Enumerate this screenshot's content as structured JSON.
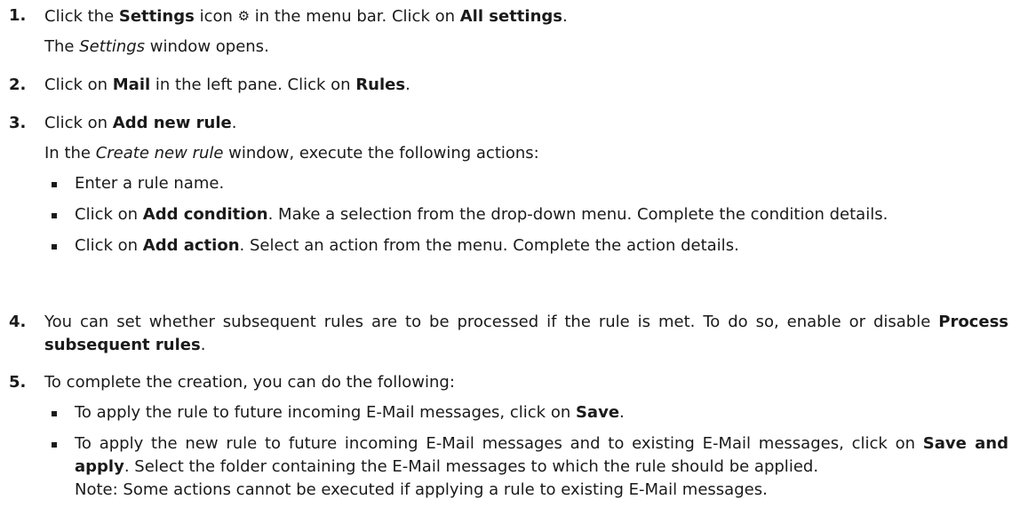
{
  "steps": [
    {
      "number": "1.",
      "t1": "Click the ",
      "b1": "Settings",
      "t2": " icon ",
      "icon": "⚙",
      "t3": " in the menu bar. Click on ",
      "b2": "All settings",
      "t4": ".",
      "sub_pre": "The ",
      "sub_em": "Settings",
      "sub_post": " window opens."
    },
    {
      "number": "2.",
      "t1": "Click on ",
      "b1": "Mail",
      "t2": " in the left pane. Click on ",
      "b2": "Rules",
      "t3": "."
    },
    {
      "number": "3.",
      "t1": "Click on ",
      "b1": "Add new rule",
      "t2": ".",
      "sub_pre": "In the ",
      "sub_em": "Create new rule",
      "sub_post": " window, execute the following actions:",
      "bullets": [
        {
          "text": "Enter a rule name."
        },
        {
          "t1": "Click on ",
          "b1": "Add condition",
          "t2": ". Make a selection from the drop-down menu. Complete the condition details."
        },
        {
          "t1": "Click on ",
          "b1": "Add action",
          "t2": ". Select an action from the menu. Complete the action details."
        }
      ]
    },
    {
      "number": "4.",
      "t1": "You can set whether subsequent rules are to be processed if the rule is met. To do so, enable or disable ",
      "b1": "Process subsequent rules",
      "t2": "."
    },
    {
      "number": "5.",
      "t1": "To complete the creation, you can do the following:",
      "bullets": [
        {
          "t1": "To apply the rule to future incoming E-Mail messages, click on ",
          "b1": "Save",
          "t2": "."
        },
        {
          "t1": "To apply the new rule to future incoming E-Mail messages and to existing E-Mail messages, click on ",
          "b1": "Save and apply",
          "t2": ". Select the folder containing the E-Mail messages to which the rule should be applied.",
          "note": "Note: Some actions cannot be executed if applying a rule to existing E-Mail messages."
        }
      ]
    }
  ]
}
